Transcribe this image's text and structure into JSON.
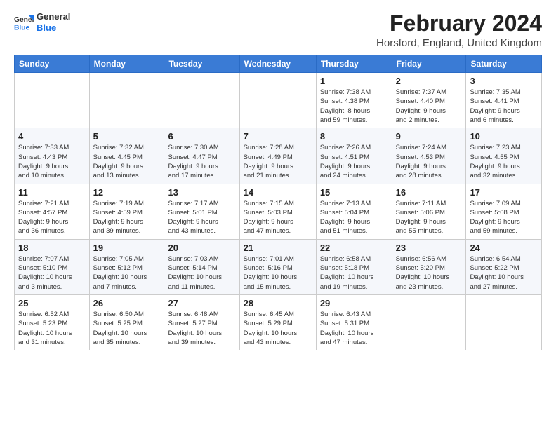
{
  "logo": {
    "general": "General",
    "blue": "Blue"
  },
  "title": "February 2024",
  "location": "Horsford, England, United Kingdom",
  "headers": [
    "Sunday",
    "Monday",
    "Tuesday",
    "Wednesday",
    "Thursday",
    "Friday",
    "Saturday"
  ],
  "weeks": [
    [
      {
        "day": "",
        "info": ""
      },
      {
        "day": "",
        "info": ""
      },
      {
        "day": "",
        "info": ""
      },
      {
        "day": "",
        "info": ""
      },
      {
        "day": "1",
        "info": "Sunrise: 7:38 AM\nSunset: 4:38 PM\nDaylight: 8 hours\nand 59 minutes."
      },
      {
        "day": "2",
        "info": "Sunrise: 7:37 AM\nSunset: 4:40 PM\nDaylight: 9 hours\nand 2 minutes."
      },
      {
        "day": "3",
        "info": "Sunrise: 7:35 AM\nSunset: 4:41 PM\nDaylight: 9 hours\nand 6 minutes."
      }
    ],
    [
      {
        "day": "4",
        "info": "Sunrise: 7:33 AM\nSunset: 4:43 PM\nDaylight: 9 hours\nand 10 minutes."
      },
      {
        "day": "5",
        "info": "Sunrise: 7:32 AM\nSunset: 4:45 PM\nDaylight: 9 hours\nand 13 minutes."
      },
      {
        "day": "6",
        "info": "Sunrise: 7:30 AM\nSunset: 4:47 PM\nDaylight: 9 hours\nand 17 minutes."
      },
      {
        "day": "7",
        "info": "Sunrise: 7:28 AM\nSunset: 4:49 PM\nDaylight: 9 hours\nand 21 minutes."
      },
      {
        "day": "8",
        "info": "Sunrise: 7:26 AM\nSunset: 4:51 PM\nDaylight: 9 hours\nand 24 minutes."
      },
      {
        "day": "9",
        "info": "Sunrise: 7:24 AM\nSunset: 4:53 PM\nDaylight: 9 hours\nand 28 minutes."
      },
      {
        "day": "10",
        "info": "Sunrise: 7:23 AM\nSunset: 4:55 PM\nDaylight: 9 hours\nand 32 minutes."
      }
    ],
    [
      {
        "day": "11",
        "info": "Sunrise: 7:21 AM\nSunset: 4:57 PM\nDaylight: 9 hours\nand 36 minutes."
      },
      {
        "day": "12",
        "info": "Sunrise: 7:19 AM\nSunset: 4:59 PM\nDaylight: 9 hours\nand 39 minutes."
      },
      {
        "day": "13",
        "info": "Sunrise: 7:17 AM\nSunset: 5:01 PM\nDaylight: 9 hours\nand 43 minutes."
      },
      {
        "day": "14",
        "info": "Sunrise: 7:15 AM\nSunset: 5:03 PM\nDaylight: 9 hours\nand 47 minutes."
      },
      {
        "day": "15",
        "info": "Sunrise: 7:13 AM\nSunset: 5:04 PM\nDaylight: 9 hours\nand 51 minutes."
      },
      {
        "day": "16",
        "info": "Sunrise: 7:11 AM\nSunset: 5:06 PM\nDaylight: 9 hours\nand 55 minutes."
      },
      {
        "day": "17",
        "info": "Sunrise: 7:09 AM\nSunset: 5:08 PM\nDaylight: 9 hours\nand 59 minutes."
      }
    ],
    [
      {
        "day": "18",
        "info": "Sunrise: 7:07 AM\nSunset: 5:10 PM\nDaylight: 10 hours\nand 3 minutes."
      },
      {
        "day": "19",
        "info": "Sunrise: 7:05 AM\nSunset: 5:12 PM\nDaylight: 10 hours\nand 7 minutes."
      },
      {
        "day": "20",
        "info": "Sunrise: 7:03 AM\nSunset: 5:14 PM\nDaylight: 10 hours\nand 11 minutes."
      },
      {
        "day": "21",
        "info": "Sunrise: 7:01 AM\nSunset: 5:16 PM\nDaylight: 10 hours\nand 15 minutes."
      },
      {
        "day": "22",
        "info": "Sunrise: 6:58 AM\nSunset: 5:18 PM\nDaylight: 10 hours\nand 19 minutes."
      },
      {
        "day": "23",
        "info": "Sunrise: 6:56 AM\nSunset: 5:20 PM\nDaylight: 10 hours\nand 23 minutes."
      },
      {
        "day": "24",
        "info": "Sunrise: 6:54 AM\nSunset: 5:22 PM\nDaylight: 10 hours\nand 27 minutes."
      }
    ],
    [
      {
        "day": "25",
        "info": "Sunrise: 6:52 AM\nSunset: 5:23 PM\nDaylight: 10 hours\nand 31 minutes."
      },
      {
        "day": "26",
        "info": "Sunrise: 6:50 AM\nSunset: 5:25 PM\nDaylight: 10 hours\nand 35 minutes."
      },
      {
        "day": "27",
        "info": "Sunrise: 6:48 AM\nSunset: 5:27 PM\nDaylight: 10 hours\nand 39 minutes."
      },
      {
        "day": "28",
        "info": "Sunrise: 6:45 AM\nSunset: 5:29 PM\nDaylight: 10 hours\nand 43 minutes."
      },
      {
        "day": "29",
        "info": "Sunrise: 6:43 AM\nSunset: 5:31 PM\nDaylight: 10 hours\nand 47 minutes."
      },
      {
        "day": "",
        "info": ""
      },
      {
        "day": "",
        "info": ""
      }
    ]
  ]
}
